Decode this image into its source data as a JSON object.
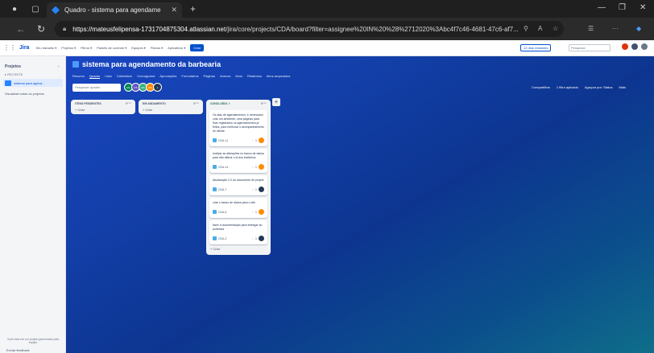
{
  "browser": {
    "tab_title": "Quadro - sistema para agendame",
    "url_host": "https://mateusfelipensa-1731704875304.atlassian.net",
    "url_path": "/jira/core/projects/CDA/board?filter=assignee%20IN%20%28%2712020%3Abc4f7c46-4681-47c6-af7..."
  },
  "jira_nav": {
    "logo": "Jira",
    "menus": [
      "Seu trabalho ▾",
      "Projetos ▾",
      "Filtros ▾",
      "Painéis de controle ▾",
      "Equipes ▾",
      "Planos ▾",
      "Aplicativos ▾"
    ],
    "create": "Criar",
    "trial": "12 dias restantes",
    "search_placeholder": "Pesquisar"
  },
  "sidebar": {
    "title": "Projetos",
    "recent": "▸ RECENTE",
    "project": "sistema para agend...",
    "all_projects": "Visualizar todos os projetos",
    "footer_note": "Você está em um projeto gerenciado pela equipe",
    "feedback": "Enviar feedback"
  },
  "board": {
    "title": "sistema para agendamento da barbearia",
    "tabs": [
      "Resumo",
      "Quadro",
      "Lista",
      "Calendário",
      "Cronograma",
      "Aprovações",
      "Formulários",
      "Páginas",
      "Anexos",
      "Itens",
      "Relatórios",
      "Itens arquivados"
    ],
    "search_placeholder": "Pesquisar quadro",
    "avatars": [
      "ML",
      "DS",
      "MA",
      "RF",
      "J"
    ],
    "right_actions": [
      "Compartilhar",
      "1 filtro aplicado",
      "Agrupar por: Status",
      "Mais"
    ],
    "columns": [
      {
        "name": "ITENS PENDENTES",
        "count": "0",
        "create": "+ Criar",
        "cards": []
      },
      {
        "name": "EM ANDAMENTO",
        "count": "0",
        "create": "+ Criar",
        "cards": []
      },
      {
        "name": "CONCLUÍDO ✓",
        "count": "5",
        "create": "+ Criar",
        "cards": [
          {
            "summary": "Os dias de agendamentos, é necessário criar um ambiente, uma páginas para ficar registrados os agendamentos já feitos, para melhorar o acompanhamento do cliente",
            "key": "CDA-11",
            "points": "1"
          },
          {
            "summary": "realizar as alterações no banco de dados para não alterar o id dos barbeiros",
            "key": "CDA-14",
            "points": "1"
          },
          {
            "summary": "Atualização 2.0 do documento de projeto",
            "key": "CDA-7",
            "points": "1"
          },
          {
            "summary": "criar o banco de dados para o site",
            "key": "CDA-6",
            "points": "1"
          },
          {
            "summary": "fazer a documentação para entregar ao professor",
            "key": "CDA-2",
            "points": "1"
          }
        ]
      }
    ]
  },
  "colors": {
    "accent": "#0052cc",
    "board_bg_start": "#1a46c2",
    "board_bg_end": "#0f6e8a"
  }
}
